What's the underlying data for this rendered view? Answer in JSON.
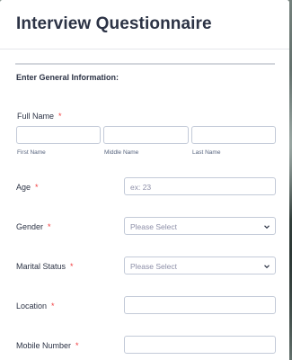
{
  "form": {
    "title": "Interview Questionnaire",
    "section_label": "Enter General Information:",
    "full_name": {
      "label": "Full Name",
      "required_mark": "*",
      "first_sublabel": "First Name",
      "middle_sublabel": "Middle Name",
      "last_sublabel": "Last Name"
    },
    "age": {
      "label": "Age",
      "required_mark": "*",
      "placeholder": "ex: 23"
    },
    "gender": {
      "label": "Gender",
      "required_mark": "*",
      "selected": "Please Select"
    },
    "marital_status": {
      "label": "Marital Status",
      "required_mark": "*",
      "selected": "Please Select"
    },
    "location": {
      "label": "Location",
      "required_mark": "*"
    },
    "mobile_number": {
      "label": "Mobile Number",
      "required_mark": "*"
    }
  },
  "colors": {
    "required": "#f23a3c",
    "text": "#2c3345",
    "input_border": "#c3cad8"
  }
}
